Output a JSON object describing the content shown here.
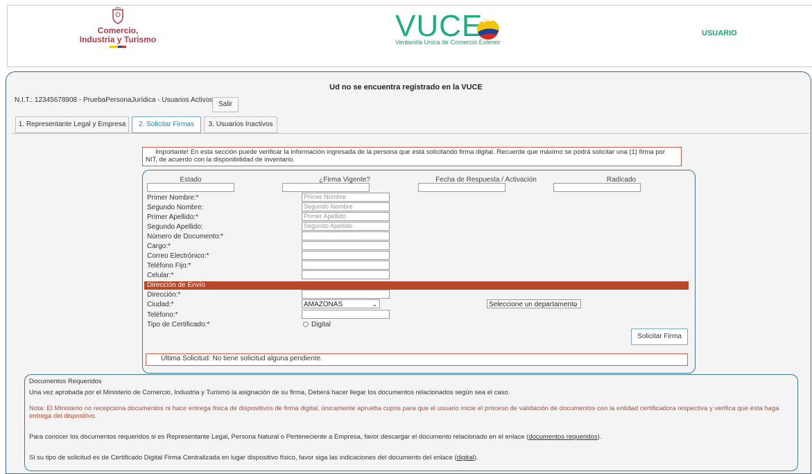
{
  "header": {
    "ministry_logo_line1": "Comercio,",
    "ministry_logo_line2": "Industria y Turismo",
    "vuce_title": "VUCE",
    "vuce_subtitle": "Ventanilla Unica de Comercio Exterior",
    "user_label": "USUARIO"
  },
  "page": {
    "title": "Ud no se encuentra registrado en la VUCE",
    "nit_info": "N.I.T.: 12345678908 - PruebaPersonaJurídica - Usuarios Activos: 0",
    "salir_label": "Salir"
  },
  "tabs": [
    {
      "label": "1. Representante Legal y Empresa",
      "active": false
    },
    {
      "label": "2. Solicitar Firmas",
      "active": true
    },
    {
      "label": "3. Usuarios Inactivos",
      "active": false
    }
  ],
  "notice": "Importante! En esta sección puede verificar la información ingresada de la persona que está solicitando firma digital. Recuerde que máximo se podrá solicitar una (1) firma por NIT, de acuerdo con la disponibilidad de inventario.",
  "columns": [
    "Estado",
    "¿Firma Vigente?",
    "Fecha de Respuesta / Activación",
    "Radicado"
  ],
  "form": {
    "fields": [
      {
        "label": "Primer Nombre:*",
        "placeholder": "Primer Nombre"
      },
      {
        "label": "Segundo Nombre:",
        "placeholder": "Segundo Nombre"
      },
      {
        "label": "Primer Apellido:*",
        "placeholder": "Primer Apellido"
      },
      {
        "label": "Segundo Apellido:",
        "placeholder": "Segundo Apellido"
      },
      {
        "label": "Número de Documento:*",
        "placeholder": ""
      },
      {
        "label": "Cargo:*",
        "placeholder": ""
      },
      {
        "label": "Correo Electrónico:*",
        "placeholder": ""
      },
      {
        "label": "Teléfono Fijo:*",
        "placeholder": ""
      },
      {
        "label": "Celular:*",
        "placeholder": ""
      }
    ],
    "section_title": "Dirección de Envío",
    "direccion_label": "Dirección:*",
    "ciudad_label": "Ciudad:*",
    "ciudad_value": "AMAZONAS",
    "departamento_value": "Seleccione un departamento",
    "telefono_label": "Teléfono:*",
    "tipo_label": "Tipo de Certificado:*",
    "tipo_option": "Digital",
    "solicitar_label": "Solicitar Firma",
    "ultima": "Última Solicitud: No tiene solicitud alguna pendiente."
  },
  "docs": {
    "title": "Documentos Requeridos",
    "line1": "Una vez aprobada por el Ministerio de Comercio, Industria y Turismo la asignación de su firma, Deberá hacer llegar los documentos relacionados según sea el caso.",
    "note": "Nota: El Ministerio no recepciona documentos ni hace entrega física de dispositivos de firma digital, únicamente aprueba cupos para que el usuario inicie el proceso de validación de documentos con la entidad certificadora respectiva y verifica que ésta haga entrega del dispositivo.",
    "line3_pre": "Para conocer los documentos requeridos si es Representante Legal, Persona Natural o Perteneciente a Empresa, favor descargar el documento relacionado en el enlace (",
    "line3_link": "documentos requeridos",
    "line3_post": ").",
    "line4_pre": "Si su tipo de solicitud es de Certificado Digital Firma Centralizada en lugar dispositivo físico, favor siga las indicaciones del documento del enlace (",
    "line4_link": "digital",
    "line4_post": ")."
  }
}
